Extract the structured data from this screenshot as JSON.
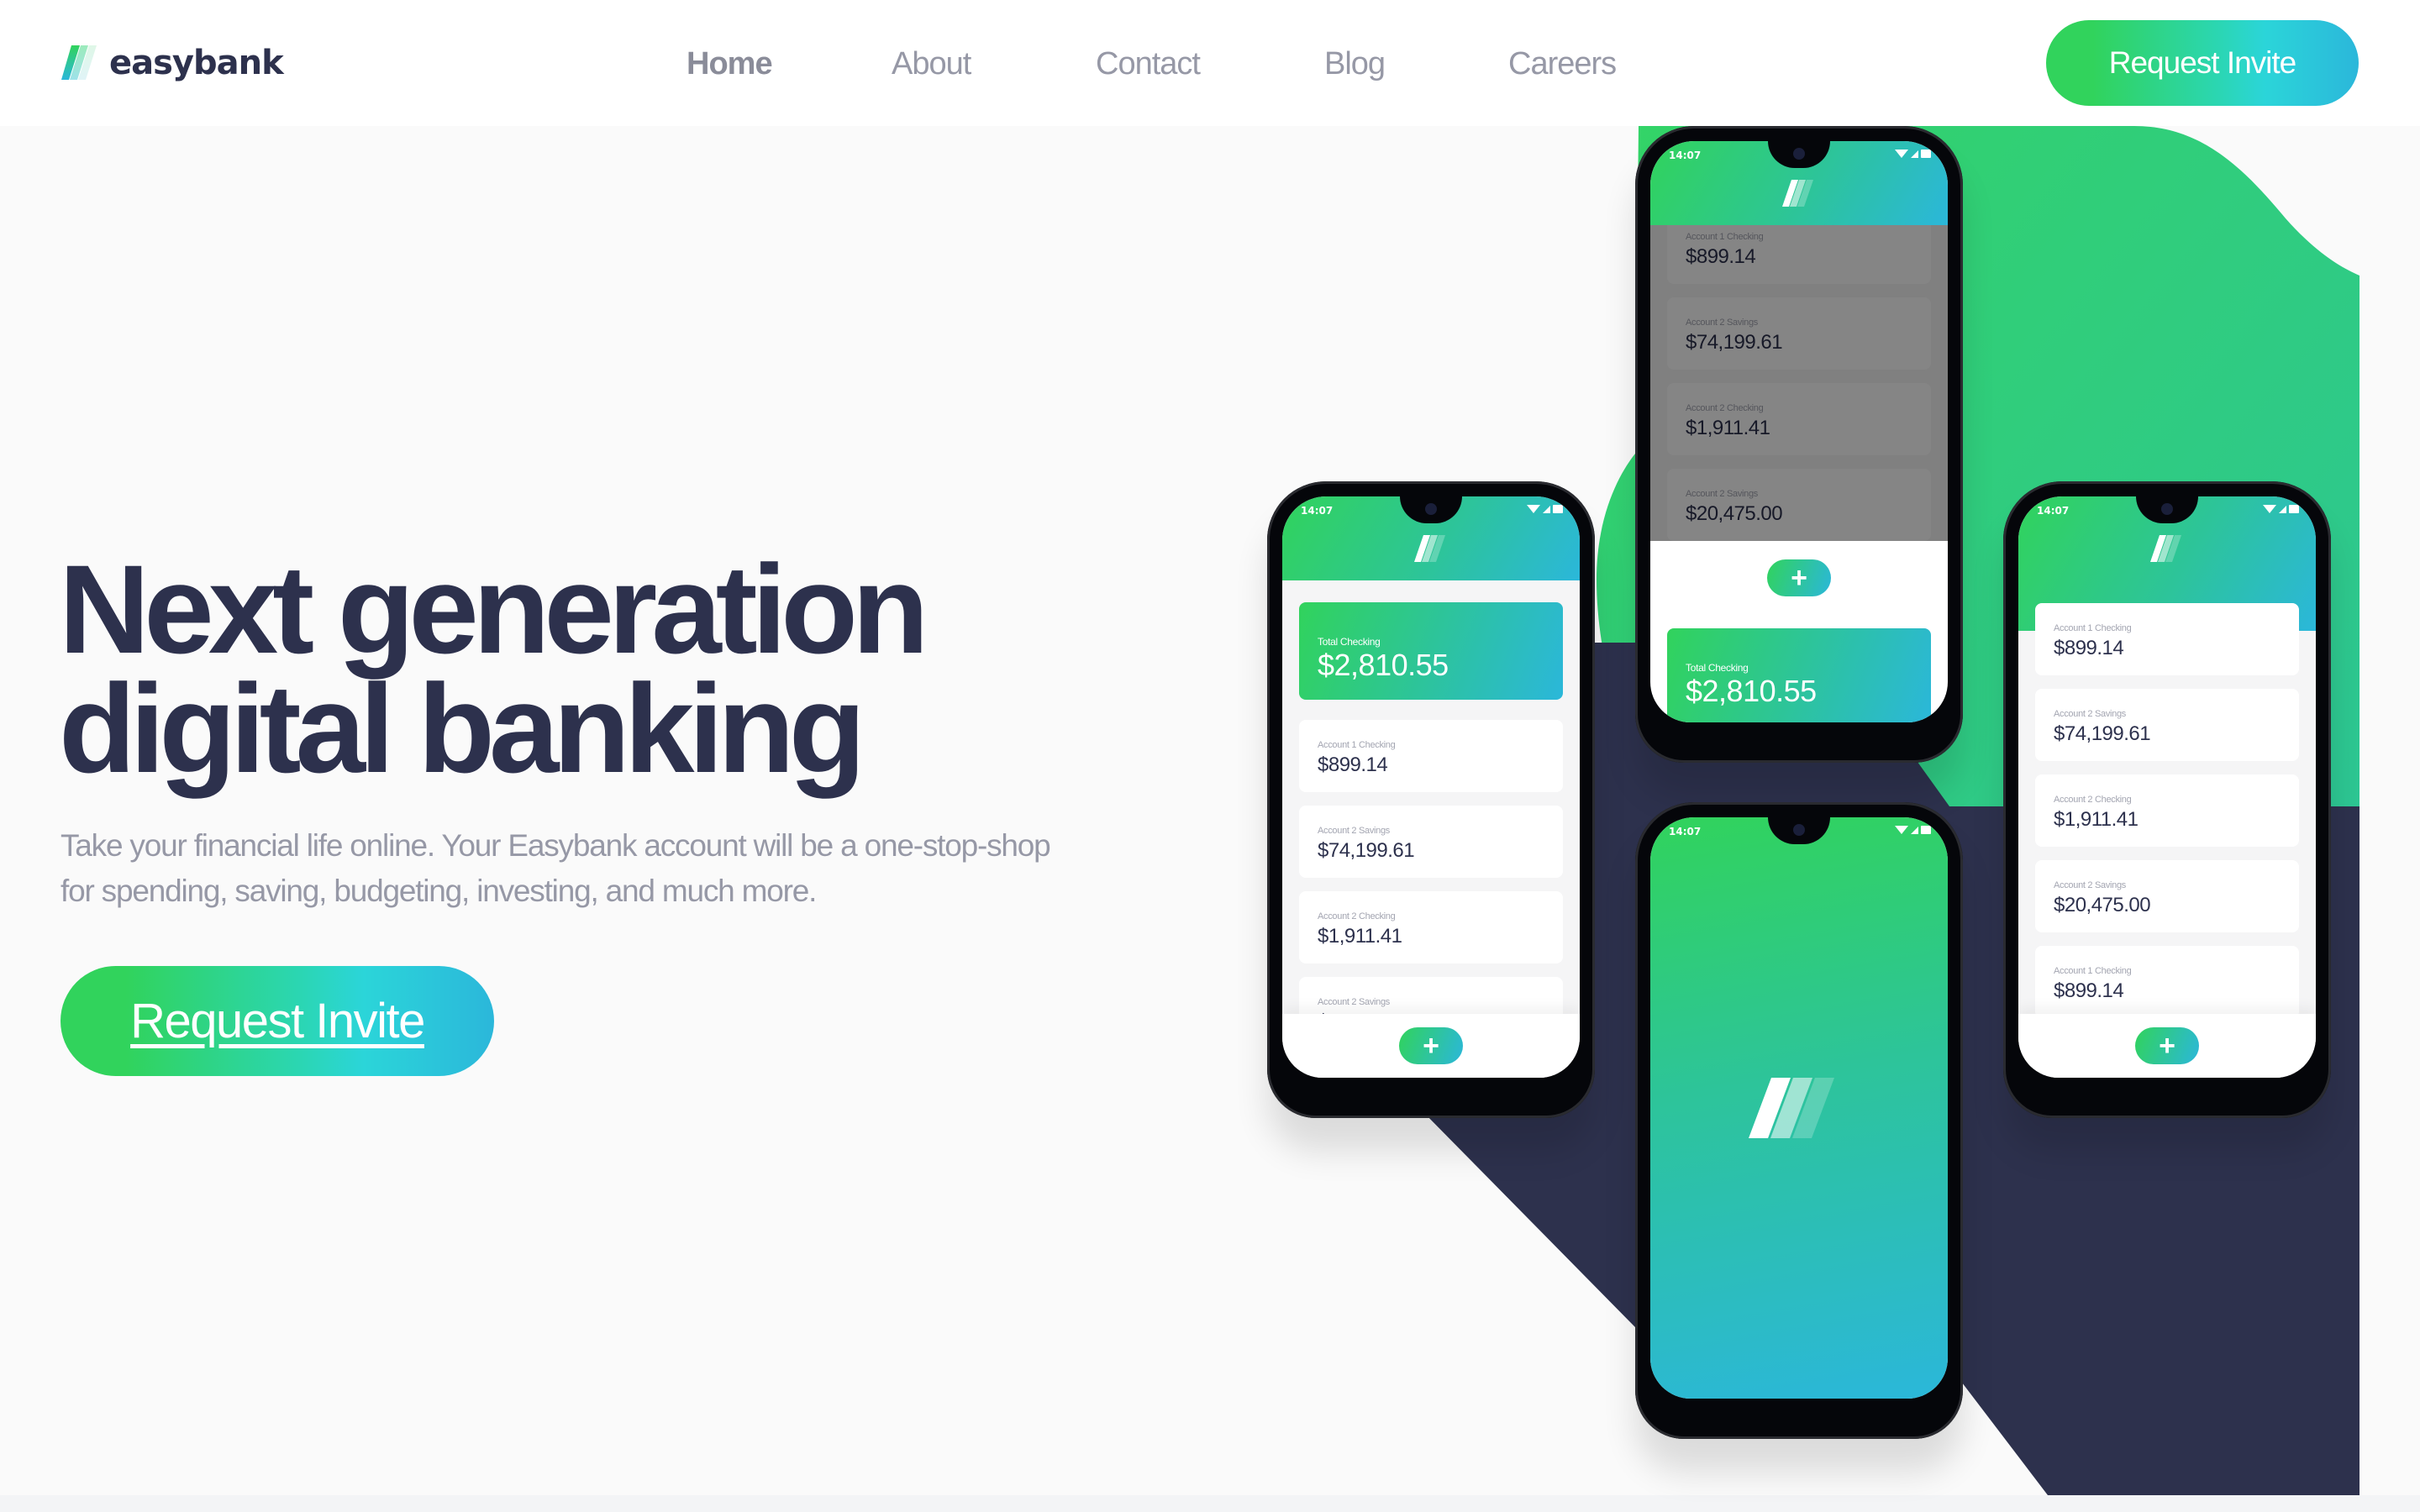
{
  "brand": {
    "name": "easybank",
    "colors": {
      "dark_blue": "#2d314d",
      "lime_green": "#31d35c",
      "bright_cyan": "#2bb7da",
      "grayish_blue": "#9698a6",
      "very_light_gray": "#fafafa"
    }
  },
  "header": {
    "logo_text": "easybank",
    "nav": [
      {
        "label": "Home",
        "active": true
      },
      {
        "label": "About",
        "active": false
      },
      {
        "label": "Contact",
        "active": false
      },
      {
        "label": "Blog",
        "active": false
      },
      {
        "label": "Careers",
        "active": false
      }
    ],
    "cta_label": "Request Invite"
  },
  "hero": {
    "headline_line1": "Next generation",
    "headline_line2": "digital banking",
    "description": "Take your financial life online. Your Easybank account will be a one-stop-shop for spending, saving, budgeting, investing, and much more.",
    "cta_label": "Request Invite"
  },
  "mockups": {
    "status_time": "14:07",
    "fab_icon": "plus-icon",
    "total": {
      "label": "Total Checking",
      "amount": "$2,810.55"
    },
    "accounts": [
      {
        "label": "Account 1 Checking",
        "amount": "$899.14"
      },
      {
        "label": "Account 2 Savings",
        "amount": "$74,199.61"
      },
      {
        "label": "Account 2 Checking",
        "amount": "$1,911.41"
      },
      {
        "label": "Account 2 Savings",
        "amount": "$20,475.00"
      },
      {
        "label": "Account 1 Checking",
        "amount": "$899.14"
      }
    ]
  }
}
